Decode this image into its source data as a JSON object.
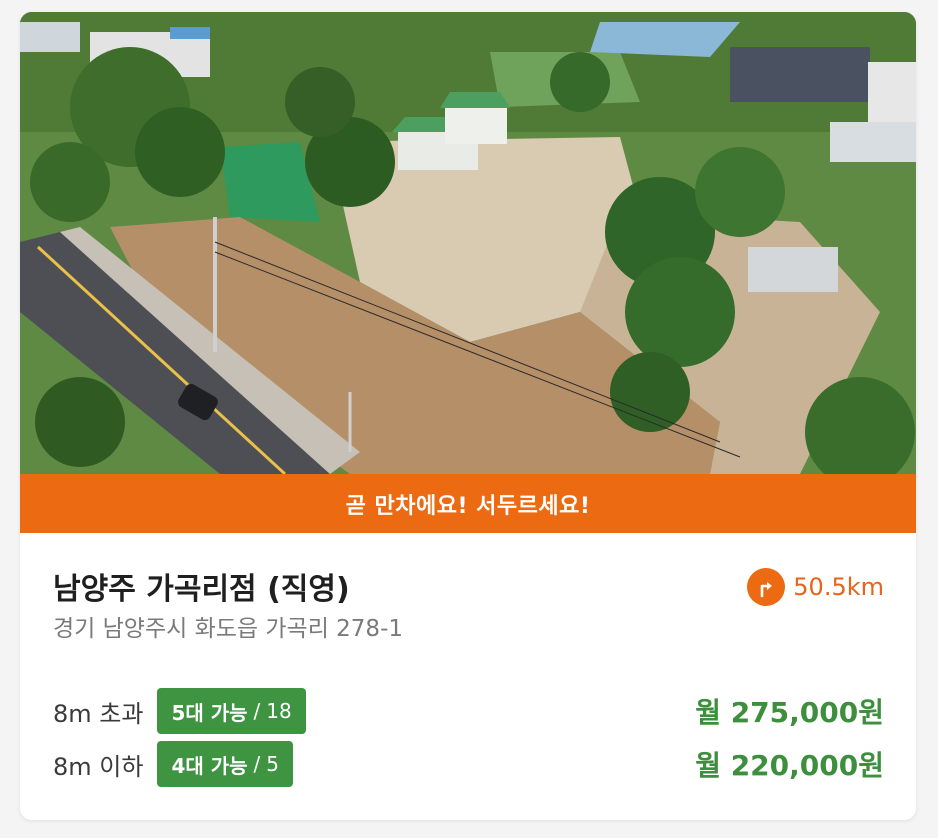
{
  "card": {
    "photo_alt": "aerial-parking-lot-photo",
    "banner": "곧 만차에요! 서두르세요!",
    "title": "남양주 가곡리점 (직영)",
    "address": "경기 남양주시 화도읍 가곡리 278-1",
    "distance": "50.5km",
    "distance_icon": "directions-turn-icon",
    "rows": [
      {
        "condition": "8m 초과",
        "available": "5대 가능",
        "separator": "/",
        "total": "18",
        "price": "월 275,000원"
      },
      {
        "condition": "8m 이하",
        "available": "4대 가능",
        "separator": "/",
        "total": "5",
        "price": "월 220,000원"
      }
    ]
  },
  "colors": {
    "accent": "#ec6a12",
    "badge_green": "#3f9442",
    "price_green": "#3d8f3e"
  }
}
